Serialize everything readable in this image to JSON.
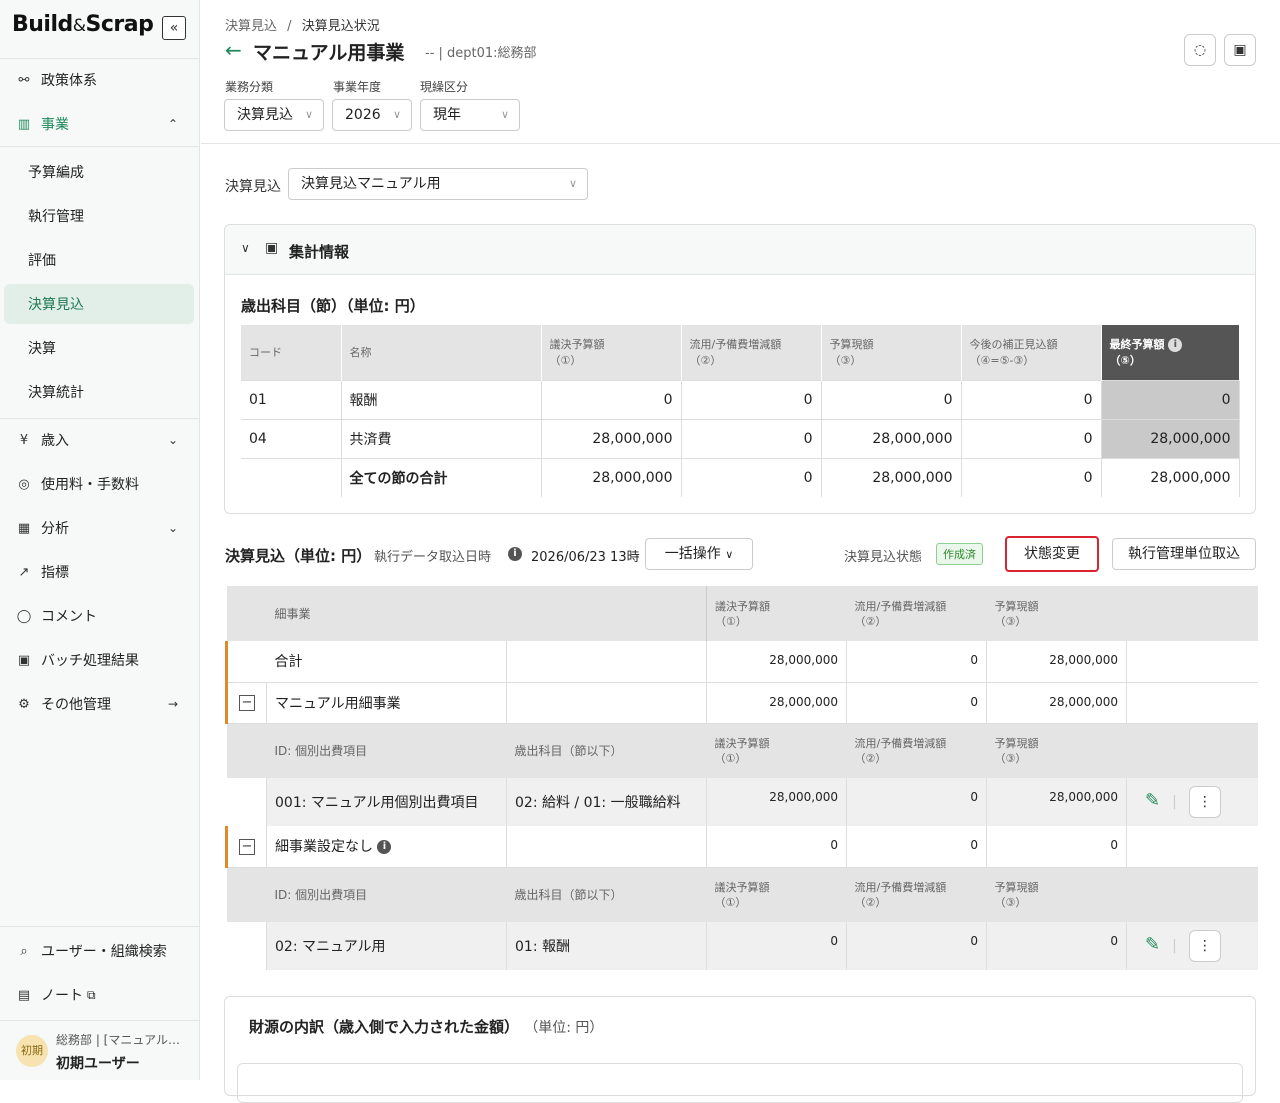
{
  "sidebar": {
    "logo_a": "Build",
    "logo_amp": "&",
    "logo_b": "Scrap",
    "collapse": "«",
    "items": [
      {
        "label": "政策体系",
        "icon": "⚯"
      },
      {
        "label": "事業",
        "icon": "▥",
        "trail": "⌃"
      },
      {
        "label": "歳入",
        "icon": "¥",
        "trail": "⌄"
      },
      {
        "label": "使用料・手数料",
        "icon": "◎"
      },
      {
        "label": "分析",
        "icon": "▦",
        "trail": "⌄"
      },
      {
        "label": "指標",
        "icon": "↗"
      },
      {
        "label": "コメント",
        "icon": "◯"
      },
      {
        "label": "バッチ処理結果",
        "icon": "▣"
      },
      {
        "label": "その他管理",
        "icon": "⚙",
        "trail": "→"
      }
    ],
    "sub_items": [
      "予算編成",
      "執行管理",
      "評価",
      "決算見込",
      "決算",
      "決算統計"
    ],
    "bottom": [
      {
        "label": "ユーザー・組織検索",
        "icon": "⌕"
      },
      {
        "label": "ノート",
        "icon": "▤",
        "trail": "⧉"
      }
    ],
    "user": {
      "avatar": "初期",
      "org": "総務部 | [マニュアル…",
      "name": "初期ユーザー"
    }
  },
  "header": {
    "crumb1": "決算見込",
    "crumb_sep": "/",
    "crumb2": "決算見込状況",
    "back": "←",
    "title": "マニュアル用事業",
    "subtitle": "-- | dept01:総務部",
    "filters": [
      {
        "label": "業務分類",
        "value": "決算見込"
      },
      {
        "label": "事業年度",
        "value": "2026"
      },
      {
        "label": "現繰区分",
        "value": "現年"
      }
    ]
  },
  "selector": {
    "label": "決算見込",
    "value": "決算見込マニュアル用"
  },
  "summary": {
    "title": "集計情報",
    "section_title": "歳出科目（節）（単位: 円）",
    "headers": [
      {
        "a": "コード",
        "b": ""
      },
      {
        "a": "名称",
        "b": ""
      },
      {
        "a": "議決予算額",
        "b": "（①）"
      },
      {
        "a": "流用/予備費増減額",
        "b": "（②）"
      },
      {
        "a": "予算現額",
        "b": "（③）"
      },
      {
        "a": "今後の補正見込額",
        "b": "（④=⑤-③）"
      },
      {
        "a": "最終予算額",
        "b": "（⑤）"
      }
    ],
    "rows": [
      {
        "code": "01",
        "name": "報酬",
        "v1": "0",
        "v2": "0",
        "v3": "0",
        "v4": "0",
        "v5": "0"
      },
      {
        "code": "04",
        "name": "共済費",
        "v1": "28,000,000",
        "v2": "0",
        "v3": "28,000,000",
        "v4": "0",
        "v5": "28,000,000"
      },
      {
        "code": "",
        "name": "全ての節の合計",
        "v1": "28,000,000",
        "v2": "0",
        "v3": "28,000,000",
        "v4": "0",
        "v5": "28,000,000"
      }
    ]
  },
  "estimate": {
    "title": "決算見込（単位: 円）",
    "import_label": "執行データ取込日時",
    "import_value": "2026/06/23 13時",
    "bulk": "一括操作",
    "status_label": "決算見込状態",
    "status_badge": "作成済",
    "change_btn": "状態変更",
    "import_btn": "執行管理単位取込",
    "col_detail": "細事業",
    "col_id": "ID: 個別出費項目",
    "col_subject": "歳出科目（節以下）",
    "c1a": "議決予算額",
    "c1b": "（①）",
    "c2a": "流用/予備費増減額",
    "c2b": "（②）",
    "c3a": "予算現額",
    "c3b": "（③）",
    "total": {
      "name": "合計",
      "v1": "28,000,000",
      "v2": "0",
      "v3": "28,000,000"
    },
    "group1": {
      "name": "マニュアル用細事業",
      "v1": "28,000,000",
      "v2": "0",
      "v3": "28,000,000"
    },
    "item1": {
      "id": "001: マニュアル用個別出費項目",
      "subject": "02: 給料 / 01: 一般職給料",
      "v1": "28,000,000",
      "v2": "0",
      "v3": "28,000,000"
    },
    "group2": {
      "name": "細事業設定なし",
      "v1": "0",
      "v2": "0",
      "v3": "0"
    },
    "item2": {
      "id": "02: マニュアル用",
      "subject": "01: 報酬",
      "v1": "0",
      "v2": "0",
      "v3": "0"
    }
  },
  "source": {
    "title": "財源の内訳（歳入側で入力された金額）",
    "unit": "（単位: 円）"
  }
}
